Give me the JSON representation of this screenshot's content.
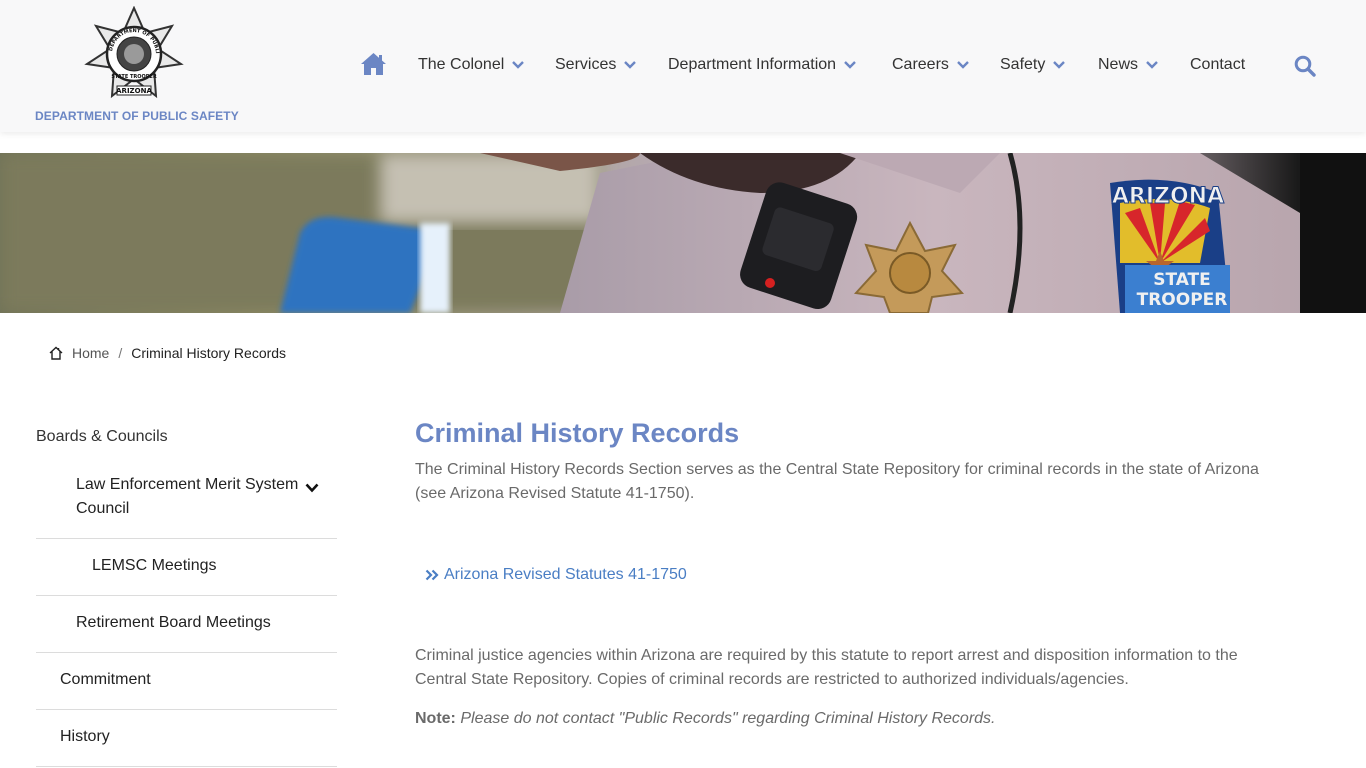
{
  "header": {
    "logo": {
      "badge_text_top": "DEPARTMENT OF PUBLIC SAFETY",
      "badge_text_state": "STATE TROOPER",
      "badge_text_bottom": "ARIZONA",
      "caption": "DEPARTMENT OF PUBLIC SAFETY"
    },
    "nav": {
      "home_icon": "home-icon",
      "items": [
        {
          "label": "The Colonel",
          "has_dropdown": true
        },
        {
          "label": "Services",
          "has_dropdown": true
        },
        {
          "label": "Department Information",
          "has_dropdown": true
        },
        {
          "label": "Careers",
          "has_dropdown": true
        },
        {
          "label": "Safety",
          "has_dropdown": true
        },
        {
          "label": "News",
          "has_dropdown": true
        },
        {
          "label": "Contact",
          "has_dropdown": false
        }
      ],
      "search_icon": "search-icon"
    }
  },
  "hero": {
    "patch_line1": "ARIZONA",
    "patch_line2": "STATE",
    "patch_line3": "TROOPER"
  },
  "breadcrumb": {
    "home": "Home",
    "separator": "/",
    "current": "Criminal History Records"
  },
  "sidebar": {
    "title": "Boards & Councils",
    "items": [
      {
        "label_line1": "Law Enforcement Merit System",
        "label_line2": "Council",
        "expandable": true
      },
      {
        "label": "LEMSC Meetings"
      },
      {
        "label": "Retirement Board Meetings"
      },
      {
        "label": "Commitment"
      },
      {
        "label": "History"
      }
    ]
  },
  "main": {
    "title": "Criminal History Records",
    "intro_line1": "The Criminal History Records Section serves as the Central State Repository for criminal records in the state of Arizona",
    "intro_line2": "(see Arizona Revised Statute 41-1750).",
    "statute_link": "Arizona Revised Statutes 41-1750",
    "body_line1": "Criminal justice agencies within Arizona are required by this statute to report arrest and disposition information to the",
    "body_line2": "Central State Repository. Copies of criminal records are restricted to authorized individuals/agencies.",
    "note_label": "Note:",
    "note_text": "Please do not contact \"Public Records\" regarding Criminal History Records."
  },
  "colors": {
    "brand_blue": "#6b86c4",
    "link_blue": "#4a7ec4",
    "header_bg": "#f8f8f9",
    "body_text": "#6a6a6a"
  }
}
